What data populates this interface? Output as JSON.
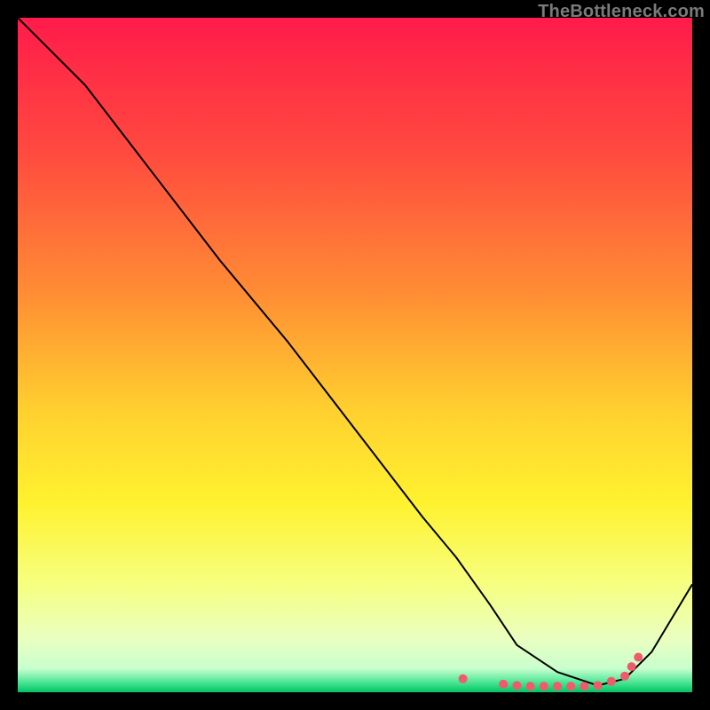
{
  "watermark": "TheBottleneck.com",
  "chart_data": {
    "type": "line",
    "title": "",
    "xlabel": "",
    "ylabel": "",
    "xlim": [
      0,
      100
    ],
    "ylim": [
      0,
      100
    ],
    "grid": false,
    "legend": false,
    "series": [
      {
        "name": "bottleneck-curve",
        "stroke": "#000000",
        "x": [
          0,
          10,
          20,
          30,
          40,
          50,
          60,
          65,
          70,
          74,
          80,
          86,
          90,
          94,
          100
        ],
        "y": [
          100,
          90,
          77,
          64,
          52,
          39,
          26,
          20,
          13,
          7,
          3,
          1,
          2,
          6,
          16
        ]
      }
    ],
    "markers": {
      "name": "highlight-dots",
      "color": "#f15a6a",
      "radius_px": 5,
      "x": [
        66,
        72,
        74,
        76,
        78,
        80,
        82,
        84,
        86,
        88,
        90,
        91,
        92
      ],
      "y": [
        2,
        1.2,
        1.0,
        0.9,
        0.9,
        0.9,
        0.9,
        0.9,
        1.0,
        1.6,
        2.4,
        3.8,
        5.2
      ]
    },
    "background_gradient": {
      "top": "#ff1744",
      "mid_upper": "#ff6e40",
      "mid": "#ffe838",
      "mid_lower": "#f2ff9c",
      "bottom": "#00e676"
    }
  }
}
